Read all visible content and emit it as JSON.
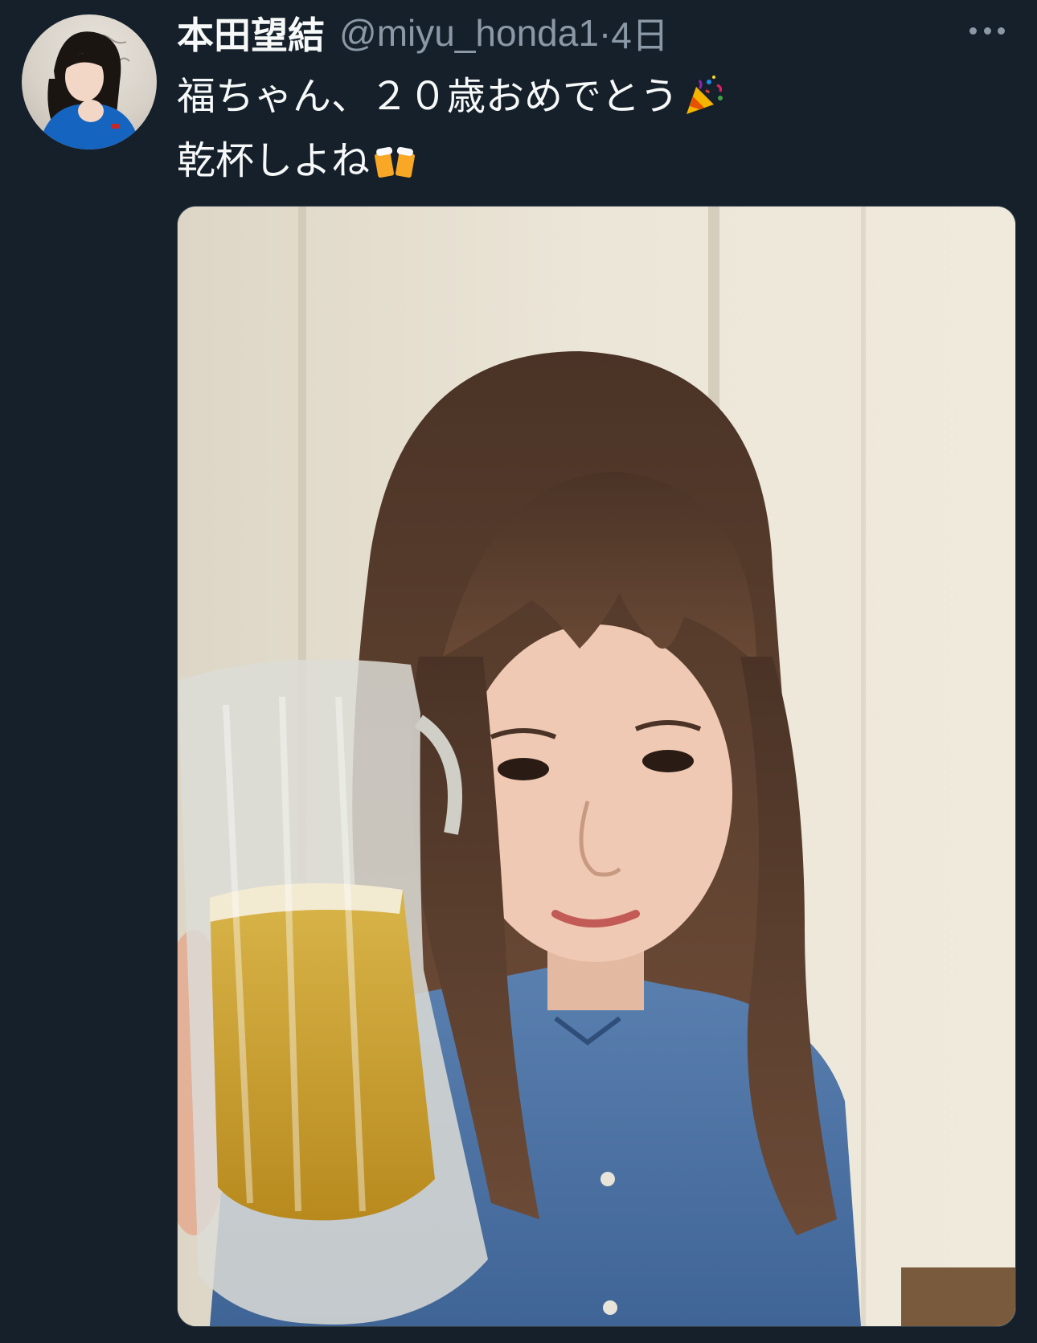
{
  "author": {
    "display_name": "本田望結",
    "handle": "@miyu_honda1",
    "separator": "·",
    "timestamp": "4日"
  },
  "tweet": {
    "line1": "福ちゃん、２０歳おめでとう",
    "line1_emoji": "party-popper-emoji",
    "line2": "乾杯しよね",
    "line2_emoji": "clinking-beer-mugs-emoji"
  },
  "icons": {
    "more": "more-horizontal-icon"
  },
  "colors": {
    "background": "#15202b",
    "primary_text": "#f7f9f9",
    "secondary_text": "#8b98a5",
    "media_border": "#38444d"
  }
}
